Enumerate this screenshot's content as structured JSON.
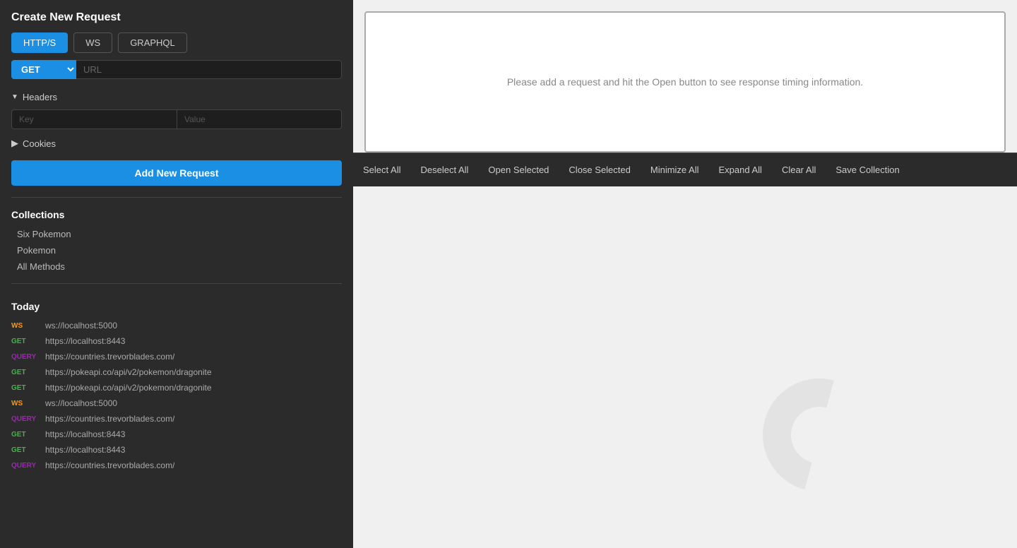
{
  "sidebar": {
    "title": "Create New Request",
    "protocols": [
      {
        "label": "HTTP/S",
        "active": true
      },
      {
        "label": "WS",
        "active": false
      },
      {
        "label": "GRAPHQL",
        "active": false
      }
    ],
    "method": "GET",
    "url_placeholder": "URL",
    "headers_label": "Headers",
    "headers_key_placeholder": "Key",
    "headers_value_placeholder": "Value",
    "cookies_label": "Cookies",
    "add_request_label": "Add New Request",
    "collections_title": "Collections",
    "collections": [
      {
        "name": "Six Pokemon"
      },
      {
        "name": "Pokemon"
      },
      {
        "name": "All Methods"
      }
    ],
    "history_title": "Today",
    "history": [
      {
        "method": "WS",
        "url": "ws://localhost:5000",
        "badge_class": "badge-ws"
      },
      {
        "method": "GET",
        "url": "https://localhost:8443",
        "badge_class": "badge-get"
      },
      {
        "method": "QUERY",
        "url": "https://countries.trevorblades.com/",
        "badge_class": "badge-query"
      },
      {
        "method": "GET",
        "url": "https://pokeapi.co/api/v2/pokemon/dragonite",
        "badge_class": "badge-get"
      },
      {
        "method": "GET",
        "url": "https://pokeapi.co/api/v2/pokemon/dragonite",
        "badge_class": "badge-get"
      },
      {
        "method": "WS",
        "url": "ws://localhost:5000",
        "badge_class": "badge-ws"
      },
      {
        "method": "QUERY",
        "url": "https://countries.trevorblades.com/",
        "badge_class": "badge-query"
      },
      {
        "method": "GET",
        "url": "https://localhost:8443",
        "badge_class": "badge-get"
      },
      {
        "method": "GET",
        "url": "https://localhost:8443",
        "badge_class": "badge-get"
      },
      {
        "method": "QUERY",
        "url": "https://countries.trevorblades.com/",
        "badge_class": "badge-query"
      }
    ]
  },
  "main": {
    "preview_placeholder": "Please add a request and hit the Open button to see response timing information.",
    "toolbar": [
      {
        "id": "select-all",
        "label": "Select All"
      },
      {
        "id": "deselect-all",
        "label": "Deselect All"
      },
      {
        "id": "open-selected",
        "label": "Open Selected"
      },
      {
        "id": "close-selected",
        "label": "Close Selected"
      },
      {
        "id": "minimize-all",
        "label": "Minimize All"
      },
      {
        "id": "expand-all",
        "label": "Expand All"
      },
      {
        "id": "clear-all",
        "label": "Clear All"
      },
      {
        "id": "save-collection",
        "label": "Save Collection"
      }
    ]
  }
}
